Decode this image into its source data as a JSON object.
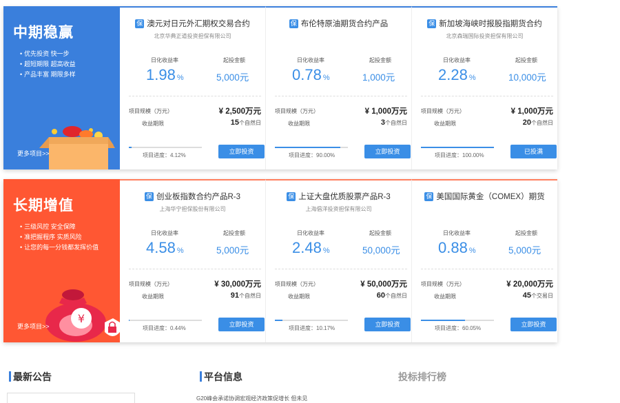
{
  "sections": [
    {
      "banner": {
        "title": "中期稳赢",
        "points": [
          "优先投资  快一步",
          "超短期限  超高收益",
          "产品丰富  期限多样"
        ],
        "more": "更多项目>>"
      },
      "labels": {
        "rate": "日化收益率",
        "min": "起投金额",
        "scale": "项目规模（万元）",
        "term": "收益期限"
      },
      "cards": [
        {
          "badge": "保",
          "title": "澳元对日元外汇期权交易合约",
          "company": "北京华典正道投资担保有限公司",
          "rate": "1.98",
          "rate_unit": "%",
          "min": "5,000元",
          "scale": "¥ 2,500万元",
          "term_num": "15",
          "term_unit": "个自然日",
          "progress": 4.12,
          "progress_text": "项目进度：4.12%",
          "button": "立即投资"
        },
        {
          "badge": "保",
          "title": "布伦特原油期货合约产品",
          "company": "",
          "rate": "0.78",
          "rate_unit": "%",
          "min": "1,000元",
          "scale": "¥ 1,000万元",
          "term_num": "3",
          "term_unit": "个自然日",
          "progress": 90.0,
          "progress_text": "项目进度：90.00%",
          "button": "立即投资"
        },
        {
          "badge": "保",
          "title": "新加坡海峡时报股指期货合约",
          "company": "北京森瑞国际投资担保有限公司",
          "rate": "2.28",
          "rate_unit": "%",
          "min": "10,000元",
          "scale": "¥ 1,000万元",
          "term_num": "20",
          "term_unit": "个自然日",
          "progress": 100.0,
          "progress_text": "项目进度：100.00%",
          "button": "已投满"
        }
      ]
    },
    {
      "banner": {
        "title": "长期增值",
        "points": [
          "三级风控  安全保障",
          "准把握程序  实质风险",
          "让您的每一分钱都发挥价值"
        ],
        "more": "更多项目>>"
      },
      "labels": {
        "rate": "日化收益率",
        "min": "起投金额",
        "scale": "项目规模（万元）",
        "term": "收益期限"
      },
      "cards": [
        {
          "badge": "保",
          "title": "创业板指数合约产品R-3",
          "company": "上海华宁担保股份有限公司",
          "rate": "4.58",
          "rate_unit": "%",
          "min": "5,000元",
          "scale": "¥ 30,000万元",
          "term_num": "91",
          "term_unit": "个自然日",
          "progress": 0.44,
          "progress_text": "项目进度：0.44%",
          "button": "立即投资"
        },
        {
          "badge": "保",
          "title": "上证大盘优质股票产品R-3",
          "company": "上海倡洋投资担保有限公司",
          "rate": "2.48",
          "rate_unit": "%",
          "min": "50,000元",
          "scale": "¥ 50,000万元",
          "term_num": "60",
          "term_unit": "个自然日",
          "progress": 10.17,
          "progress_text": "项目进度：10.17%",
          "button": "立即投资"
        },
        {
          "badge": "保",
          "title": "美国国际黄金（COMEX）期货",
          "company": "",
          "rate": "0.88",
          "rate_unit": "%",
          "min": "5,000元",
          "scale": "¥ 20,000万元",
          "term_num": "45",
          "term_unit": "个交易日",
          "progress": 60.05,
          "progress_text": "项目进度：60.05%",
          "button": "立即投资"
        }
      ]
    }
  ],
  "footer": {
    "announcements": "最新公告",
    "platform_info": "平台信息",
    "ranking": "投标排行榜",
    "news_item": "G20峰会承诺协调宏观经济政策促增长 但未见"
  },
  "colors": {
    "blue": "#3a7fdc",
    "red": "#ff5733",
    "accent": "#3a8ee6"
  }
}
